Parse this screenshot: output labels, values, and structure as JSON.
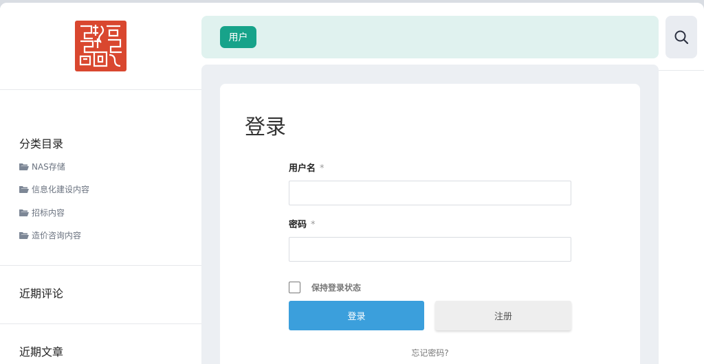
{
  "topbar": {
    "user_button": "用户",
    "search_icon": "search-icon"
  },
  "sidebar": {
    "logo_icon": "seal-logo",
    "categories_title": "分类目录",
    "categories": [
      {
        "label": "NAS存储",
        "icon": "folder-open-icon"
      },
      {
        "label": "信息化建设内容",
        "icon": "folder-open-icon"
      },
      {
        "label": "招标内容",
        "icon": "folder-open-icon"
      },
      {
        "label": "造价咨询内容",
        "icon": "folder-open-icon"
      }
    ],
    "recent_comments_title": "近期评论",
    "recent_posts_title": "近期文章"
  },
  "login": {
    "title": "登录",
    "username_label": "用户名",
    "username_required": "*",
    "username_value": "",
    "password_label": "密码",
    "password_required": "*",
    "password_value": "",
    "remember_label": "保持登录状态",
    "remember_checked": false,
    "login_button": "登录",
    "register_button": "注册",
    "forgot_link": "忘记密码?"
  },
  "colors": {
    "accent": "#17a38a",
    "login_button": "#3b9fdc",
    "topbar_bg": "#e0f2ef",
    "logo_red": "#d9472f"
  }
}
